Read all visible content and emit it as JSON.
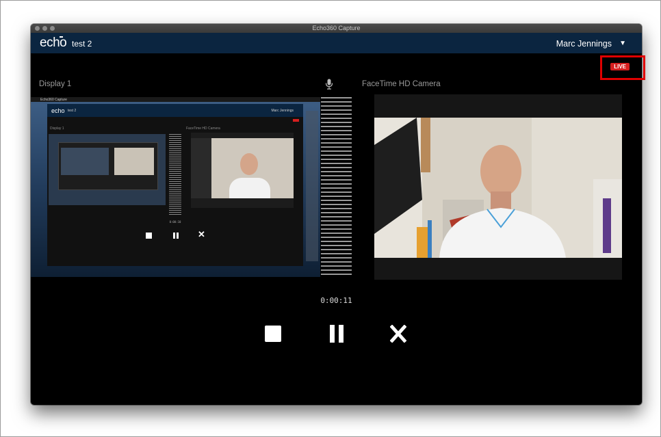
{
  "window": {
    "title": "Echo360 Capture"
  },
  "app": {
    "logo_text": "echo",
    "session_name": "test 2",
    "user_name": "Marc Jennings",
    "live_badge": "LIVE"
  },
  "sources": {
    "display_label": "Display 1",
    "camera_label": "FaceTime HD Camera"
  },
  "recording": {
    "elapsed": "0:00:11"
  },
  "controls": {
    "stop": "stop-icon",
    "pause": "pause-icon",
    "cancel": "close-icon"
  },
  "nested_preview": {
    "menu_app": "Echo360 Capture",
    "session_name": "test 2",
    "user_name": "Marc Jennings",
    "display_label": "Display 1",
    "camera_label": "FaceTime HD Camera",
    "elapsed": "0:00:10"
  },
  "colors": {
    "appbar": "#0b2540",
    "live": "#d61f1f",
    "annotation_box": "#e00000"
  }
}
